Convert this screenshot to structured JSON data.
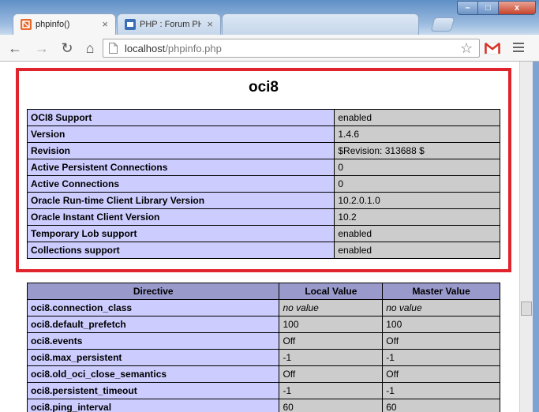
{
  "browser": {
    "tabs": [
      {
        "label": "phpinfo()",
        "close": "×"
      },
      {
        "label": "PHP : Forum PHP",
        "close": "×"
      },
      {
        "label": "",
        "close": ""
      }
    ],
    "window_controls": {
      "minimize": "–",
      "maximize": "□",
      "close": "x"
    },
    "url_host": "localhost",
    "url_path": "/phpinfo.php",
    "accent_colors": {
      "highlight_border": "#e0242d",
      "key_cell": "#ccccff",
      "value_cell": "#cccccc",
      "header_cell": "#9999cc"
    }
  },
  "section": {
    "title": "oci8",
    "rows": [
      {
        "key": "OCI8 Support",
        "value": "enabled"
      },
      {
        "key": "Version",
        "value": "1.4.6"
      },
      {
        "key": "Revision",
        "value": "$Revision: 313688 $"
      },
      {
        "key": "Active Persistent Connections",
        "value": "0"
      },
      {
        "key": "Active Connections",
        "value": "0"
      },
      {
        "key": "Oracle Run-time Client Library Version",
        "value": "10.2.0.1.0"
      },
      {
        "key": "Oracle Instant Client Version",
        "value": "10.2"
      },
      {
        "key": "Temporary Lob support",
        "value": "enabled"
      },
      {
        "key": "Collections support",
        "value": "enabled"
      }
    ]
  },
  "directives": {
    "headers": [
      "Directive",
      "Local Value",
      "Master Value"
    ],
    "rows": [
      {
        "name": "oci8.connection_class",
        "local": "no value",
        "master": "no value"
      },
      {
        "name": "oci8.default_prefetch",
        "local": "100",
        "master": "100"
      },
      {
        "name": "oci8.events",
        "local": "Off",
        "master": "Off"
      },
      {
        "name": "oci8.max_persistent",
        "local": "-1",
        "master": "-1"
      },
      {
        "name": "oci8.old_oci_close_semantics",
        "local": "Off",
        "master": "Off"
      },
      {
        "name": "oci8.persistent_timeout",
        "local": "-1",
        "master": "-1"
      },
      {
        "name": "oci8.ping_interval",
        "local": "60",
        "master": "60"
      }
    ]
  }
}
